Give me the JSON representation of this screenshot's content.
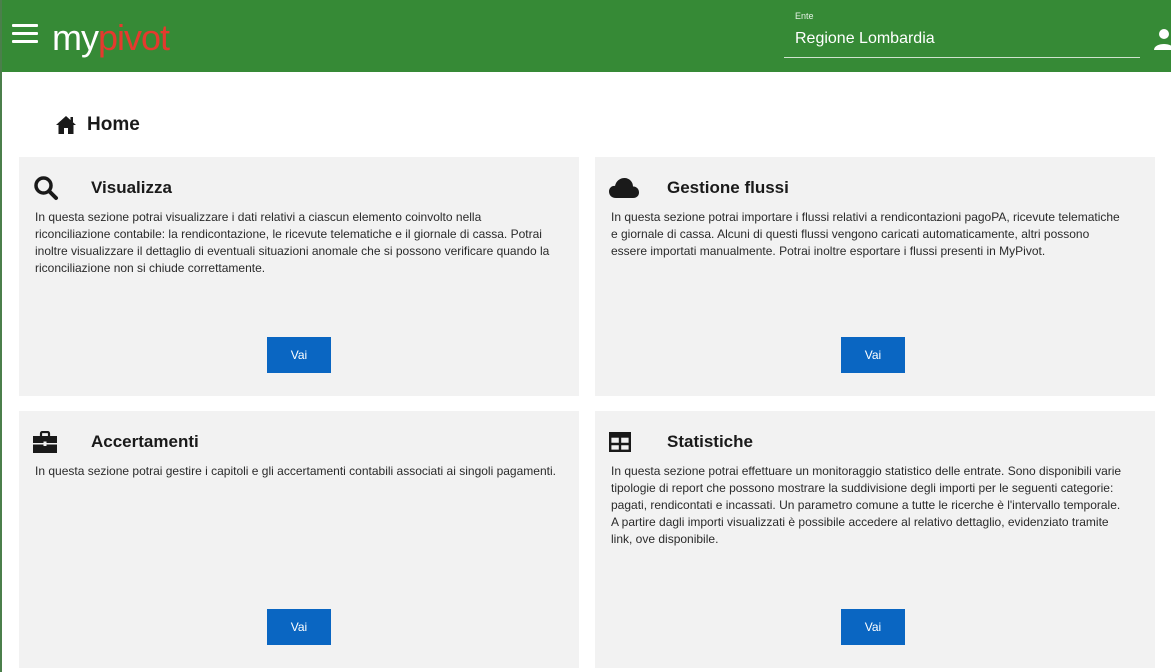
{
  "header": {
    "logo_my": "my",
    "logo_pivot": "pivot",
    "ente_label": "Ente",
    "ente_value": "Regione Lombardia"
  },
  "page": {
    "title": "Home"
  },
  "cards": [
    {
      "title": "Visualizza",
      "icon": "search-icon",
      "text": "In questa sezione potrai visualizzare i dati relativi a ciascun elemento coinvolto nella riconciliazione contabile: la rendicontazione, le ricevute telematiche e il giornale di cassa. Potrai inoltre visualizzare il dettaglio di eventuali situazioni anomale che si possono verificare quando la riconciliazione non si chiude correttamente.",
      "button": "Vai"
    },
    {
      "title": "Gestione flussi",
      "icon": "cloud-icon",
      "text": "In questa sezione potrai importare i flussi relativi a rendicontazioni pagoPA, ricevute telematiche e giornale di cassa. Alcuni di questi flussi vengono caricati automaticamente, altri possono essere importati manualmente. Potrai inoltre esportare i flussi presenti in MyPivot.",
      "button": "Vai"
    },
    {
      "title": "Accertamenti",
      "icon": "briefcase-icon",
      "text": "In questa sezione potrai gestire i capitoli e gli accertamenti contabili associati ai singoli pagamenti.",
      "button": "Vai"
    },
    {
      "title": "Statistiche",
      "icon": "table-icon",
      "text": "In questa sezione potrai effettuare un monitoraggio statistico delle entrate. Sono disponibili varie tipologie di report che possono mostrare la suddivisione degli importi per le seguenti categorie: pagati, rendicontati e incassati. Un parametro comune a tutte le ricerche è l'intervallo temporale. A partire dagli importi visualizzati è possibile accedere al relativo dettaglio, evidenziato tramite link, ove disponibile.",
      "button": "Vai"
    }
  ],
  "colors": {
    "header_bg": "#368a36",
    "logo_accent": "#e53a2e",
    "button_bg": "#0a66c2",
    "card_bg": "#f2f2f2"
  }
}
